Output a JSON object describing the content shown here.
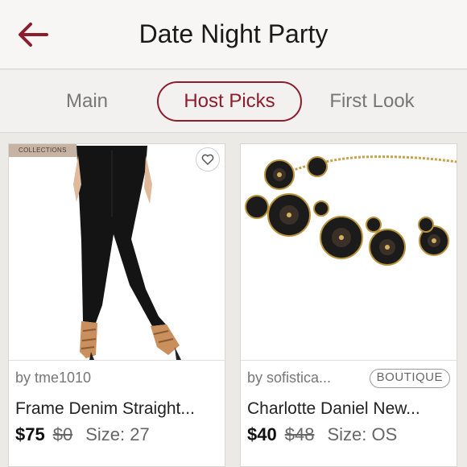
{
  "header": {
    "title": "Date Night Party",
    "back_icon": "back-arrow-icon",
    "accent": "#8b1d2c"
  },
  "tabs": [
    {
      "label": "Main",
      "active": false
    },
    {
      "label": "Host Picks",
      "active": true
    },
    {
      "label": "First Look",
      "active": false
    }
  ],
  "listings": [
    {
      "badge": "COLLECTIONS",
      "like_icon": "heart-icon",
      "seller": "by tme1010",
      "name": "Frame Denim Straight...",
      "price": "$75",
      "original_price": "$0",
      "size": "Size: 27",
      "image": "black-skinny-jeans"
    },
    {
      "seller": "by sofistica...",
      "boutique_badge": "BOUTIQUE",
      "name": "Charlotte Daniel New...",
      "price": "$40",
      "original_price": "$48",
      "size": "Size: OS",
      "image": "black-crystal-statement-necklace"
    }
  ]
}
